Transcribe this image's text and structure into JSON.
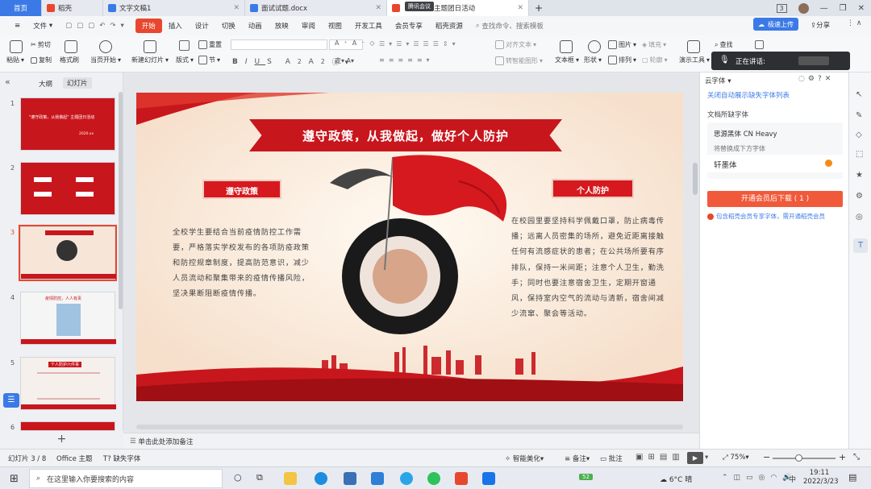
{
  "tabs": {
    "home": "首页",
    "items": [
      {
        "label": "稻壳",
        "color": "#e8472f"
      },
      {
        "label": "文字文稿1",
        "color": "#3b7ae6"
      },
      {
        "label": "面试试题.docx",
        "color": "#3b7ae6"
      },
      {
        "label": "...主题团日活动",
        "color": "#e8472f"
      }
    ],
    "overlay_label": "腾讯会议",
    "badge": "3"
  },
  "menu": {
    "file": "文件",
    "items": [
      "开始",
      "插入",
      "设计",
      "切换",
      "动画",
      "放映",
      "审阅",
      "视图",
      "开发工具",
      "会员专享",
      "稻壳资源"
    ],
    "search": "查找命令、搜索模板",
    "upload": "极速上传",
    "share": "分享"
  },
  "ribbon": {
    "paste": "粘贴",
    "cut": "剪切",
    "copy": "复制",
    "format_painter": "格式刷",
    "play_from_current": "当页开始",
    "new_slide": "新建幻灯片",
    "layout": "版式",
    "section": "节",
    "reset": "重置",
    "align_text": "对齐文本",
    "convert_smartart": "转智能图形",
    "textbox": "文本框",
    "shape": "形状",
    "picture": "图片",
    "arrange": "排列",
    "fill": "填充",
    "outline": "轮廓",
    "presenter_tools": "演示工具",
    "find": "查找",
    "replace": "替换",
    "select": "选择"
  },
  "speaking": "正在讲话:",
  "left_panel": {
    "tab_outline": "大纲",
    "tab_slides": "幻灯片",
    "slides": [
      {
        "num": "1",
        "title": "\"遵守政策，从我做起\" 主题团日活动",
        "date": "2020.xx"
      },
      {
        "num": "2"
      },
      {
        "num": "3"
      },
      {
        "num": "4",
        "title": "疫情防控，人人有责"
      },
      {
        "num": "5",
        "title": "个人防护六件事"
      },
      {
        "num": "6"
      }
    ],
    "add": "+"
  },
  "slide": {
    "banner": "遵守政策，从我做起，做好个人防护",
    "left_heading": "遵守政策",
    "left_text": "全校学生要结合当前疫情防控工作需要，严格落实学校发布的各项防疫政策和防控规章制度，提高防范意识，减少人员流动和聚集带来的疫情传播风险，坚决果断阻断疫情传播。",
    "right_heading": "个人防护",
    "right_text": "在校园里要坚持科学佩戴口罩，防止病毒传播；远离人员密集的场所，避免近距离接触任何有流感症状的患者；在公共场所要有序排队，保持一米间距；注意个人卫生，勤洗手；同时也要注意宿舍卫生，定期开窗通风，保持室内空气的流动与清新，宿舍间减少流窜、聚会等活动。"
  },
  "right_panel": {
    "title": "云字体",
    "link": "关闭自动展示缺失字体列表",
    "section": "文档所缺字体",
    "font_name": "思源黑体 CN Heavy",
    "replace_hint": "将替换成下方字体",
    "replace_font": "轩墨体",
    "cta": "开通会员后下载 ( 1 )",
    "member_note": "包含稻壳会员专享字体，需开通稻壳会员"
  },
  "notes": "单击此处添加备注",
  "status": {
    "slide": "幻灯片 3 / 8",
    "theme": "Office 主题",
    "missing_font": "缺失字体",
    "beautify": "智能美化",
    "notes": "备注",
    "comments": "批注",
    "zoom": "75%"
  },
  "taskbar": {
    "search": "在这里输入你要搜索的内容",
    "weather": "6°C 晴",
    "ime": "中",
    "time": "19:11",
    "date": "2022/3/23",
    "battery": "52"
  },
  "colors": {
    "accent": "#e8472f",
    "slide_red": "#c8161d",
    "blue": "#3b7ae6"
  }
}
